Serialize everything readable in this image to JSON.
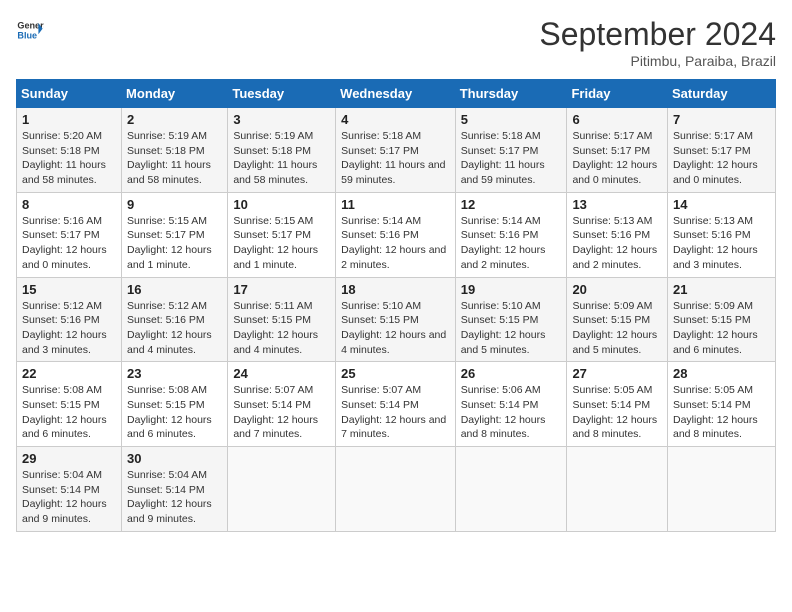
{
  "header": {
    "logo_line1": "General",
    "logo_line2": "Blue",
    "month_year": "September 2024",
    "location": "Pitimbu, Paraiba, Brazil"
  },
  "weekdays": [
    "Sunday",
    "Monday",
    "Tuesday",
    "Wednesday",
    "Thursday",
    "Friday",
    "Saturday"
  ],
  "days": [
    {
      "date": 1,
      "dow": 0,
      "sunrise": "5:20 AM",
      "sunset": "5:18 PM",
      "daylight": "11 hours and 58 minutes."
    },
    {
      "date": 2,
      "dow": 1,
      "sunrise": "5:19 AM",
      "sunset": "5:18 PM",
      "daylight": "11 hours and 58 minutes."
    },
    {
      "date": 3,
      "dow": 2,
      "sunrise": "5:19 AM",
      "sunset": "5:18 PM",
      "daylight": "11 hours and 58 minutes."
    },
    {
      "date": 4,
      "dow": 3,
      "sunrise": "5:18 AM",
      "sunset": "5:17 PM",
      "daylight": "11 hours and 59 minutes."
    },
    {
      "date": 5,
      "dow": 4,
      "sunrise": "5:18 AM",
      "sunset": "5:17 PM",
      "daylight": "11 hours and 59 minutes."
    },
    {
      "date": 6,
      "dow": 5,
      "sunrise": "5:17 AM",
      "sunset": "5:17 PM",
      "daylight": "12 hours and 0 minutes."
    },
    {
      "date": 7,
      "dow": 6,
      "sunrise": "5:17 AM",
      "sunset": "5:17 PM",
      "daylight": "12 hours and 0 minutes."
    },
    {
      "date": 8,
      "dow": 0,
      "sunrise": "5:16 AM",
      "sunset": "5:17 PM",
      "daylight": "12 hours and 0 minutes."
    },
    {
      "date": 9,
      "dow": 1,
      "sunrise": "5:15 AM",
      "sunset": "5:17 PM",
      "daylight": "12 hours and 1 minute."
    },
    {
      "date": 10,
      "dow": 2,
      "sunrise": "5:15 AM",
      "sunset": "5:17 PM",
      "daylight": "12 hours and 1 minute."
    },
    {
      "date": 11,
      "dow": 3,
      "sunrise": "5:14 AM",
      "sunset": "5:16 PM",
      "daylight": "12 hours and 2 minutes."
    },
    {
      "date": 12,
      "dow": 4,
      "sunrise": "5:14 AM",
      "sunset": "5:16 PM",
      "daylight": "12 hours and 2 minutes."
    },
    {
      "date": 13,
      "dow": 5,
      "sunrise": "5:13 AM",
      "sunset": "5:16 PM",
      "daylight": "12 hours and 2 minutes."
    },
    {
      "date": 14,
      "dow": 6,
      "sunrise": "5:13 AM",
      "sunset": "5:16 PM",
      "daylight": "12 hours and 3 minutes."
    },
    {
      "date": 15,
      "dow": 0,
      "sunrise": "5:12 AM",
      "sunset": "5:16 PM",
      "daylight": "12 hours and 3 minutes."
    },
    {
      "date": 16,
      "dow": 1,
      "sunrise": "5:12 AM",
      "sunset": "5:16 PM",
      "daylight": "12 hours and 4 minutes."
    },
    {
      "date": 17,
      "dow": 2,
      "sunrise": "5:11 AM",
      "sunset": "5:15 PM",
      "daylight": "12 hours and 4 minutes."
    },
    {
      "date": 18,
      "dow": 3,
      "sunrise": "5:10 AM",
      "sunset": "5:15 PM",
      "daylight": "12 hours and 4 minutes."
    },
    {
      "date": 19,
      "dow": 4,
      "sunrise": "5:10 AM",
      "sunset": "5:15 PM",
      "daylight": "12 hours and 5 minutes."
    },
    {
      "date": 20,
      "dow": 5,
      "sunrise": "5:09 AM",
      "sunset": "5:15 PM",
      "daylight": "12 hours and 5 minutes."
    },
    {
      "date": 21,
      "dow": 6,
      "sunrise": "5:09 AM",
      "sunset": "5:15 PM",
      "daylight": "12 hours and 6 minutes."
    },
    {
      "date": 22,
      "dow": 0,
      "sunrise": "5:08 AM",
      "sunset": "5:15 PM",
      "daylight": "12 hours and 6 minutes."
    },
    {
      "date": 23,
      "dow": 1,
      "sunrise": "5:08 AM",
      "sunset": "5:15 PM",
      "daylight": "12 hours and 6 minutes."
    },
    {
      "date": 24,
      "dow": 2,
      "sunrise": "5:07 AM",
      "sunset": "5:14 PM",
      "daylight": "12 hours and 7 minutes."
    },
    {
      "date": 25,
      "dow": 3,
      "sunrise": "5:07 AM",
      "sunset": "5:14 PM",
      "daylight": "12 hours and 7 minutes."
    },
    {
      "date": 26,
      "dow": 4,
      "sunrise": "5:06 AM",
      "sunset": "5:14 PM",
      "daylight": "12 hours and 8 minutes."
    },
    {
      "date": 27,
      "dow": 5,
      "sunrise": "5:05 AM",
      "sunset": "5:14 PM",
      "daylight": "12 hours and 8 minutes."
    },
    {
      "date": 28,
      "dow": 6,
      "sunrise": "5:05 AM",
      "sunset": "5:14 PM",
      "daylight": "12 hours and 8 minutes."
    },
    {
      "date": 29,
      "dow": 0,
      "sunrise": "5:04 AM",
      "sunset": "5:14 PM",
      "daylight": "12 hours and 9 minutes."
    },
    {
      "date": 30,
      "dow": 1,
      "sunrise": "5:04 AM",
      "sunset": "5:14 PM",
      "daylight": "12 hours and 9 minutes."
    }
  ]
}
